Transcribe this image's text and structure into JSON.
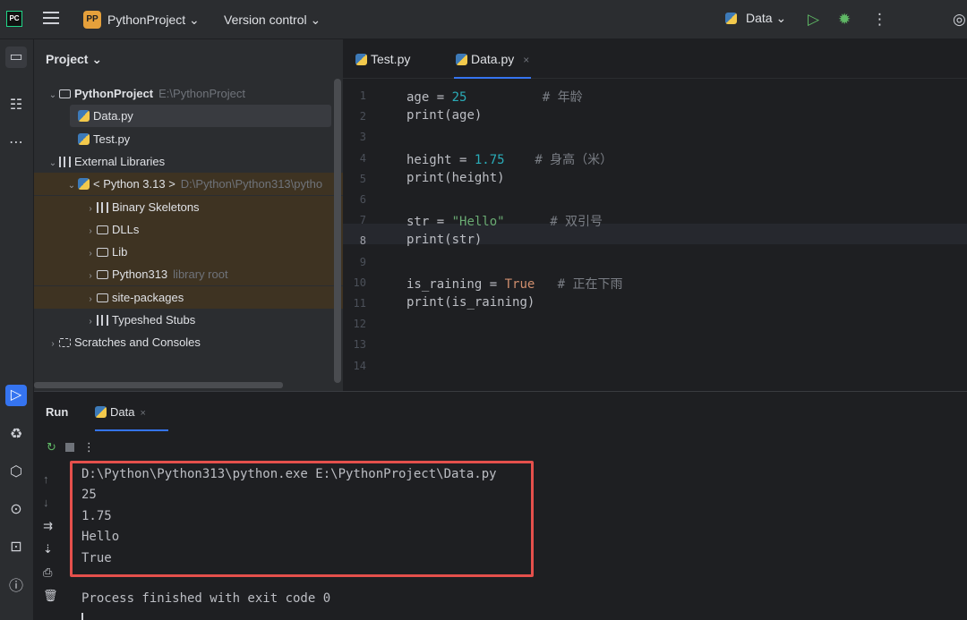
{
  "topbar": {
    "logo": "PC",
    "project_badge": "PP",
    "project_name": "PythonProject ⌄",
    "version_control": "Version control ⌄",
    "run_config": "Data ⌄",
    "icons": [
      "hamburger-icon",
      "run-icon",
      "debug-icon",
      "more-icon",
      "copilot-icon"
    ]
  },
  "left_strip": {
    "icons": [
      "folder-icon",
      "structure-icon",
      "more-icon",
      "run-icon",
      "python-console-icon",
      "services-icon",
      "problems-icon",
      "terminal-icon",
      "info-icon"
    ]
  },
  "project_panel": {
    "title": "Project ⌄",
    "tree": [
      {
        "label": "PythonProject",
        "hint": "E:\\PythonProject",
        "depth": 0,
        "chevron": "⌄",
        "icon": "folder"
      },
      {
        "label": "Data.py",
        "hint": "",
        "depth": 1,
        "chevron": "",
        "icon": "python",
        "selected": true
      },
      {
        "label": "Test.py",
        "hint": "",
        "depth": 1,
        "chevron": "",
        "icon": "python"
      },
      {
        "label": "External Libraries",
        "hint": "",
        "depth": 0,
        "chevron": "⌄",
        "icon": "libs"
      },
      {
        "label": "< Python 3.13 >",
        "hint": "D:\\Python\\Python313\\pytho",
        "depth": 1,
        "chevron": "⌄",
        "icon": "python",
        "lib": true
      },
      {
        "label": "Binary Skeletons",
        "hint": "",
        "depth": 2,
        "chevron": "›",
        "icon": "libs",
        "lib": true
      },
      {
        "label": "DLLs",
        "hint": "",
        "depth": 2,
        "chevron": "›",
        "icon": "folder",
        "lib": true
      },
      {
        "label": "Lib",
        "hint": "",
        "depth": 2,
        "chevron": "›",
        "icon": "folder",
        "lib": true
      },
      {
        "label": "Python313",
        "hint": "library root",
        "depth": 2,
        "chevron": "›",
        "icon": "folder",
        "lib": true
      },
      {
        "label": "site-packages",
        "hint": "",
        "depth": 2,
        "chevron": "›",
        "icon": "folder",
        "lib": true
      },
      {
        "label": "Typeshed Stubs",
        "hint": "",
        "depth": 2,
        "chevron": "›",
        "icon": "libs"
      },
      {
        "label": "Scratches and Consoles",
        "hint": "",
        "depth": 0,
        "chevron": "›",
        "icon": "scratch"
      }
    ]
  },
  "editor": {
    "tabs": [
      {
        "label": "Test.py",
        "active": false
      },
      {
        "label": "Data.py",
        "active": true,
        "close": "×"
      }
    ],
    "current_line": 8,
    "lines": [
      {
        "n": "1",
        "tokens": [
          [
            "var",
            "age"
          ],
          [
            "op",
            " = "
          ],
          [
            "num",
            "25"
          ],
          [
            "sp",
            "          "
          ],
          [
            "cm",
            "# 年龄"
          ]
        ]
      },
      {
        "n": "2",
        "tokens": [
          [
            "fn",
            "print"
          ],
          [
            "op",
            "(age)"
          ]
        ]
      },
      {
        "n": "3",
        "tokens": []
      },
      {
        "n": "4",
        "tokens": [
          [
            "var",
            "height"
          ],
          [
            "op",
            " = "
          ],
          [
            "num",
            "1.75"
          ],
          [
            "sp",
            "    "
          ],
          [
            "cm",
            "# 身高（米）"
          ]
        ]
      },
      {
        "n": "5",
        "tokens": [
          [
            "fn",
            "print"
          ],
          [
            "op",
            "(height)"
          ]
        ]
      },
      {
        "n": "6",
        "tokens": []
      },
      {
        "n": "7",
        "tokens": [
          [
            "var",
            "str"
          ],
          [
            "op",
            " = "
          ],
          [
            "str",
            "\"Hello\""
          ],
          [
            "sp",
            "      "
          ],
          [
            "cm",
            "# 双引号"
          ]
        ]
      },
      {
        "n": "8",
        "tokens": [
          [
            "fn",
            "print"
          ],
          [
            "op",
            "(str)"
          ]
        ]
      },
      {
        "n": "9",
        "tokens": []
      },
      {
        "n": "10",
        "tokens": [
          [
            "var",
            "is_raining"
          ],
          [
            "op",
            " = "
          ],
          [
            "kw",
            "True"
          ],
          [
            "sp",
            "   "
          ],
          [
            "cm",
            "# 正在下雨"
          ]
        ]
      },
      {
        "n": "11",
        "tokens": [
          [
            "fn",
            "print"
          ],
          [
            "op",
            "(is_raining)"
          ]
        ]
      },
      {
        "n": "12",
        "tokens": []
      },
      {
        "n": "13",
        "tokens": []
      },
      {
        "n": "14",
        "tokens": []
      }
    ]
  },
  "run_panel": {
    "title": "Run",
    "tab_label": "Data",
    "tab_close": "×",
    "output": [
      "D:\\Python\\Python313\\python.exe E:\\PythonProject\\Data.py",
      "25",
      "1.75",
      "Hello",
      "True"
    ],
    "exit_message": "Process finished with exit code 0"
  },
  "colors": {
    "accent": "#3574f0",
    "highlight_box": "#e5504c",
    "number": "#2aacb8",
    "string": "#6aab73",
    "keyword": "#cf8e6d",
    "comment": "#7a7e85"
  }
}
